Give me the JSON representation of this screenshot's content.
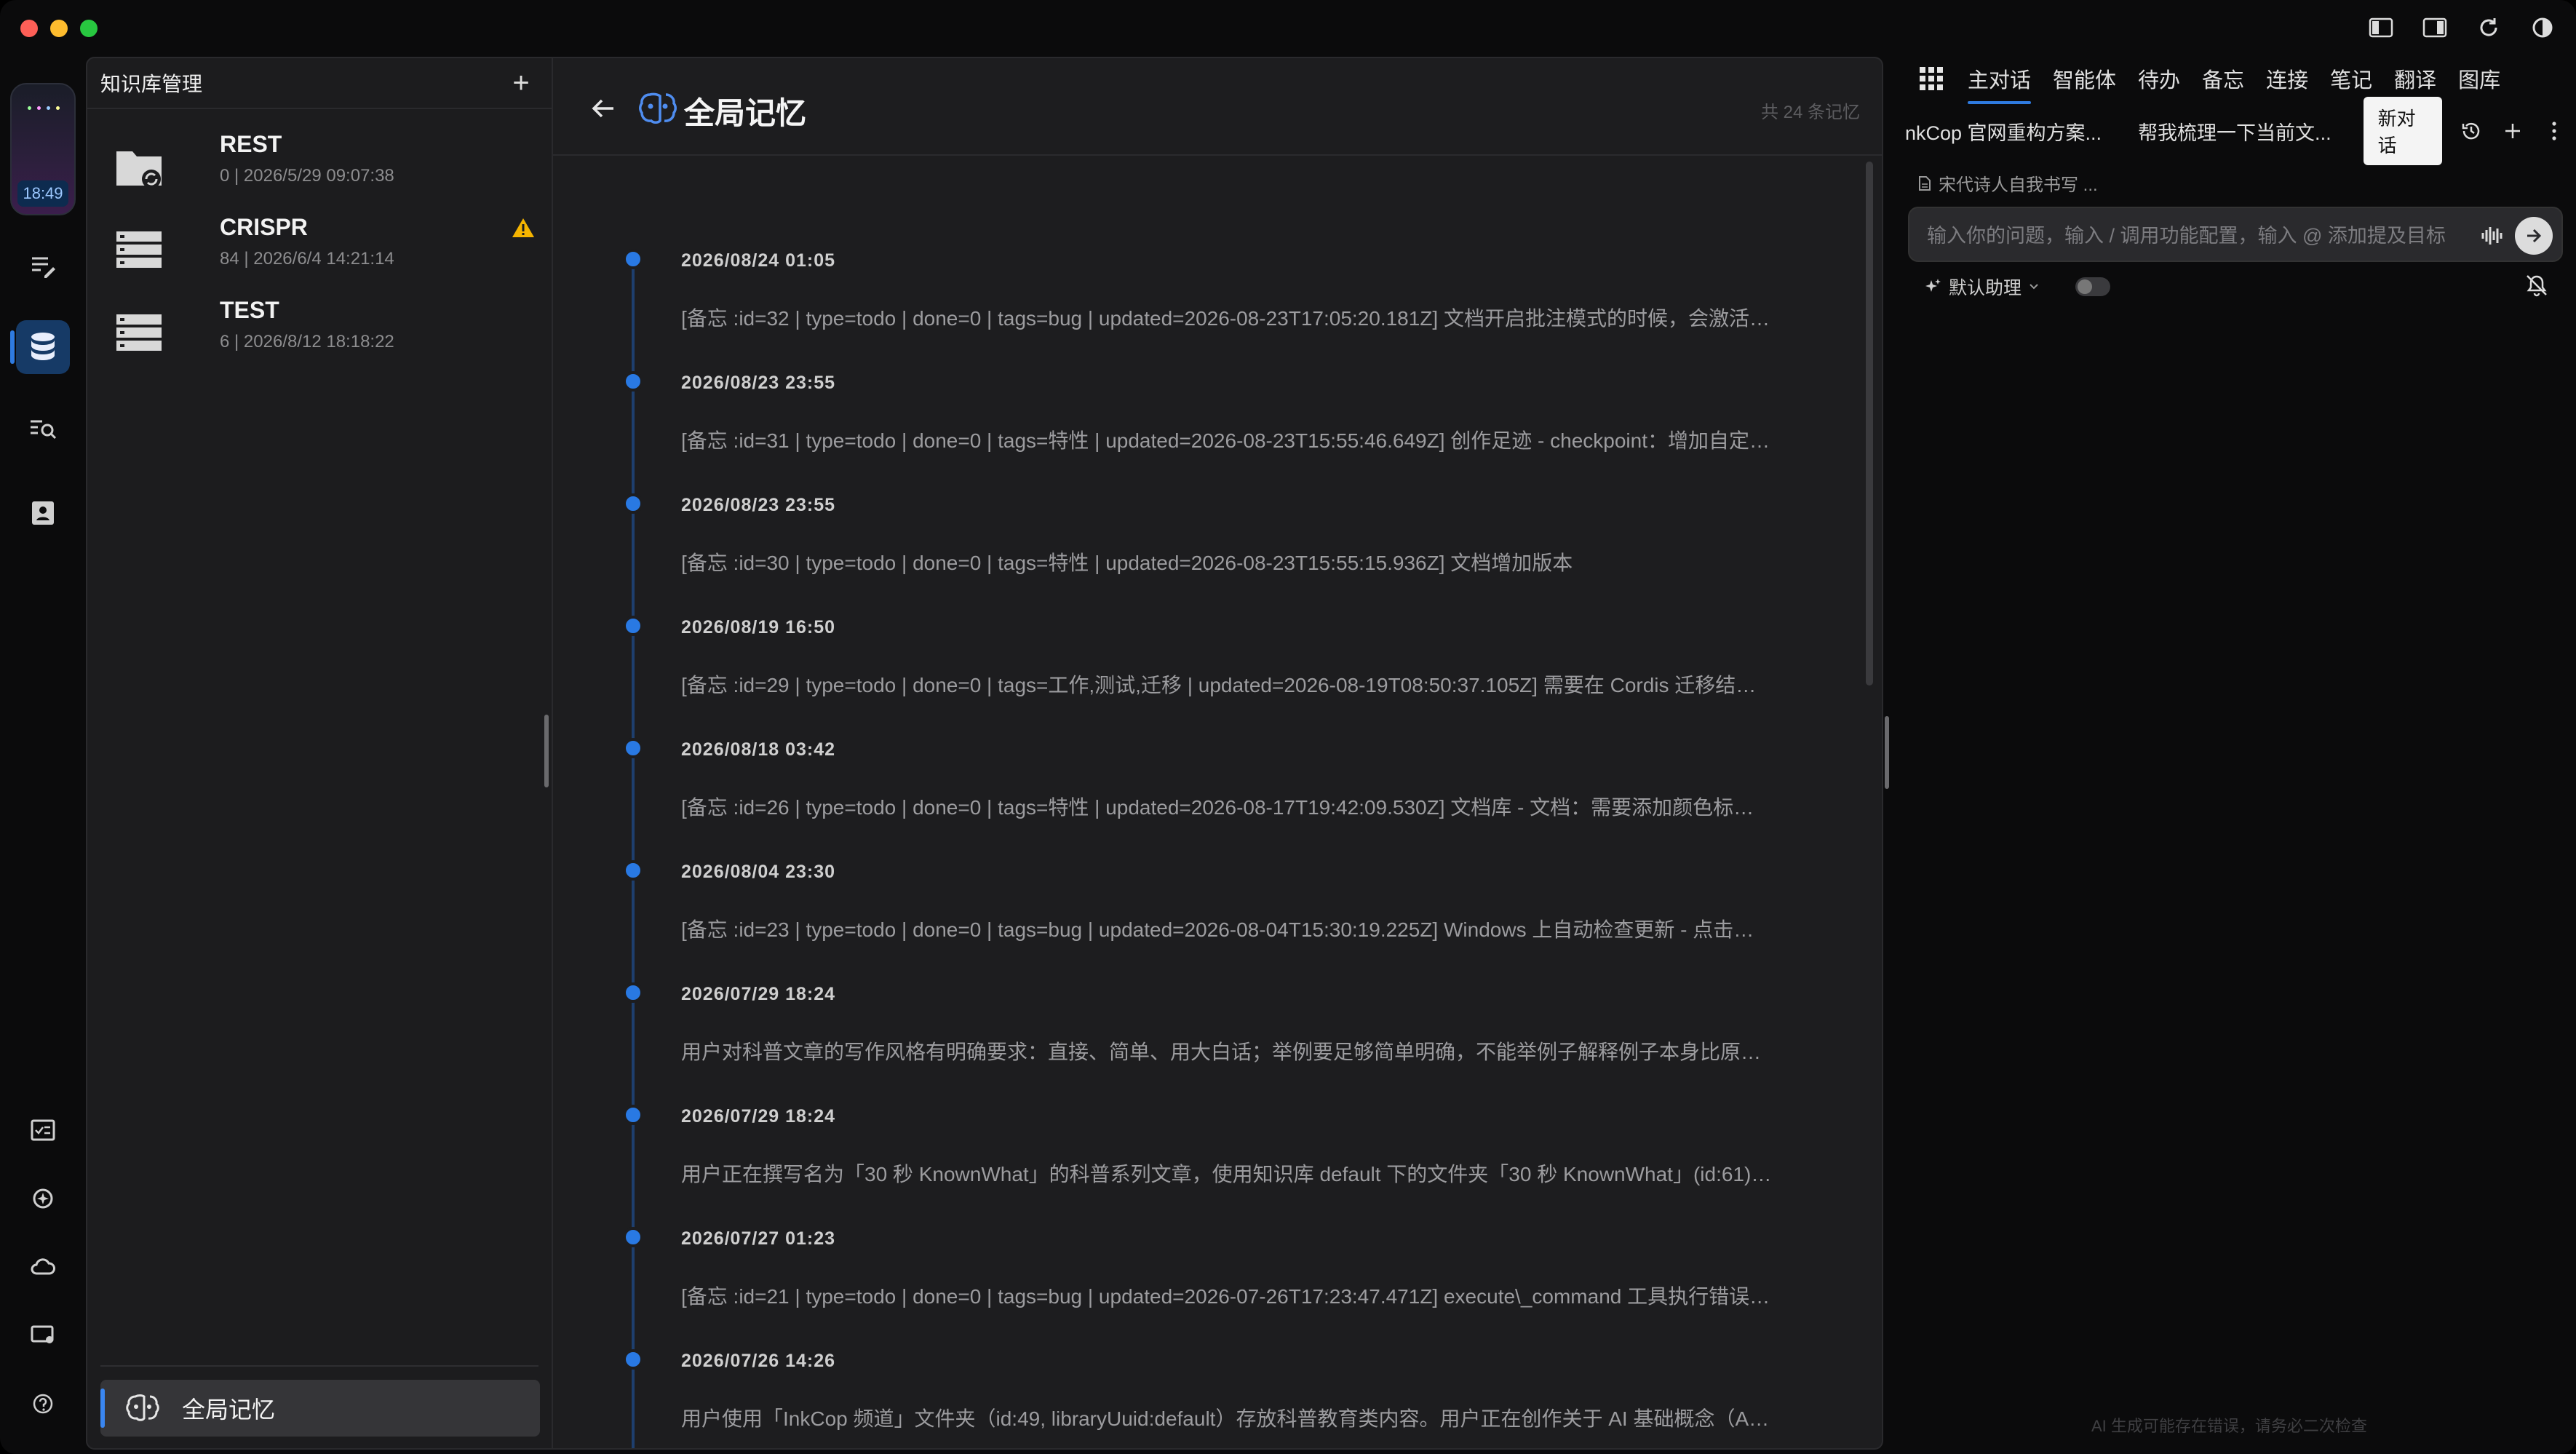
{
  "colors": {
    "accent": "#2f7be0",
    "timeline_dot": "#2979e3",
    "warning": "#f5b400"
  },
  "rail": {
    "clock_time": "18:49",
    "items": [
      {
        "icon": "edit-list-icon"
      },
      {
        "icon": "database-icon",
        "active": true
      },
      {
        "icon": "search-list-icon"
      },
      {
        "icon": "contacts-icon"
      },
      {
        "icon": "checklist-icon"
      },
      {
        "icon": "sparkle-target-icon"
      },
      {
        "icon": "cloud-icon"
      },
      {
        "icon": "display-settings-icon"
      },
      {
        "icon": "help-icon"
      }
    ]
  },
  "kb_panel": {
    "title": "知识库管理",
    "add_label": "+",
    "items": [
      {
        "name": "REST",
        "meta": "0 | 2026/5/29 09:07:38",
        "icon": "folder-sync-icon",
        "warning": false
      },
      {
        "name": "CRISPR",
        "meta": "84 | 2026/6/4 14:21:14",
        "icon": "storage-icon",
        "warning": true
      },
      {
        "name": "TEST",
        "meta": "6 | 2026/8/12 18:18:22",
        "icon": "storage-icon",
        "warning": false
      }
    ],
    "footer_label": "全局记忆"
  },
  "main": {
    "title": "全局记忆",
    "count_text": "共 24 条记忆",
    "entries": [
      {
        "date": "2026/08/24 01:05",
        "text": "[备忘 :id=32 | type=todo | done=0 | tags=bug | updated=2026-08-23T17:05:20.181Z] 文档开启批注模式的时候，会激活审查..."
      },
      {
        "date": "2026/08/23 23:55",
        "text": "[备忘 :id=31 | type=todo | done=0 | tags=特性 | updated=2026-08-23T15:55:46.649Z] 创作足迹 - checkpoint：增加自定义标..."
      },
      {
        "date": "2026/08/23 23:55",
        "text": "[备忘 :id=30 | type=todo | done=0 | tags=特性 | updated=2026-08-23T15:55:15.936Z] 文档增加版本"
      },
      {
        "date": "2026/08/19 16:50",
        "text": "[备忘 :id=29 | type=todo | done=0 | tags=工作,测试,迁移 | updated=2026-08-19T08:50:37.105Z] 需要在 Cordis 迁移结束后..."
      },
      {
        "date": "2026/08/18 03:42",
        "text": "[备忘 :id=26 | type=todo | done=0 | tags=特性 | updated=2026-08-17T19:42:09.530Z] 文档库 - 文档：需要添加颜色标签，类..."
      },
      {
        "date": "2026/08/04 23:30",
        "text": "[备忘 :id=23 | type=todo | done=0 | tags=bug | updated=2026-08-04T15:30:19.225Z] Windows 上自动检查更新 - 点击下载 - ..."
      },
      {
        "date": "2026/07/29 18:24",
        "text": "用户对科普文章的写作风格有明确要求：直接、简单、用大白话；举例要足够简单明确，不能举例子解释例子本身比原始..."
      },
      {
        "date": "2026/07/29 18:24",
        "text": "用户正在撰写名为「30 秒 KnownWhat」的科普系列文章，使用知识库 default 下的文件夹「30 秒 KnownWhat」(id:61)。..."
      },
      {
        "date": "2026/07/27 01:23",
        "text": "[备忘 :id=21 | type=todo | done=0 | tags=bug | updated=2026-07-26T17:23:47.471Z] execute\\_command 工具执行错误的信..."
      },
      {
        "date": "2026/07/26 14:26",
        "text": "用户使用「InkCop 频道」文件夹（id:49, libraryUuid:default）存放科普教育类内容。用户正在创作关于 AI 基础概念（Agen..."
      }
    ]
  },
  "chat": {
    "tabs": [
      "主对话",
      "智能体",
      "待办",
      "备忘",
      "连接",
      "笔记",
      "翻译",
      "图库"
    ],
    "active_tab": 0,
    "conversations": [
      "nkCop 官网重构方案...",
      "帮我梳理一下当前文..."
    ],
    "new_conversation": "新对话",
    "doc_chip": "宋代诗人自我书写 ...",
    "input_placeholder": "输入你的问题，输入 / 调用功能配置，输入 @ 添加提及目标",
    "assistant_label": "默认助理",
    "disclaimer": "AI 生成可能存在错误，请务必二次检查"
  }
}
